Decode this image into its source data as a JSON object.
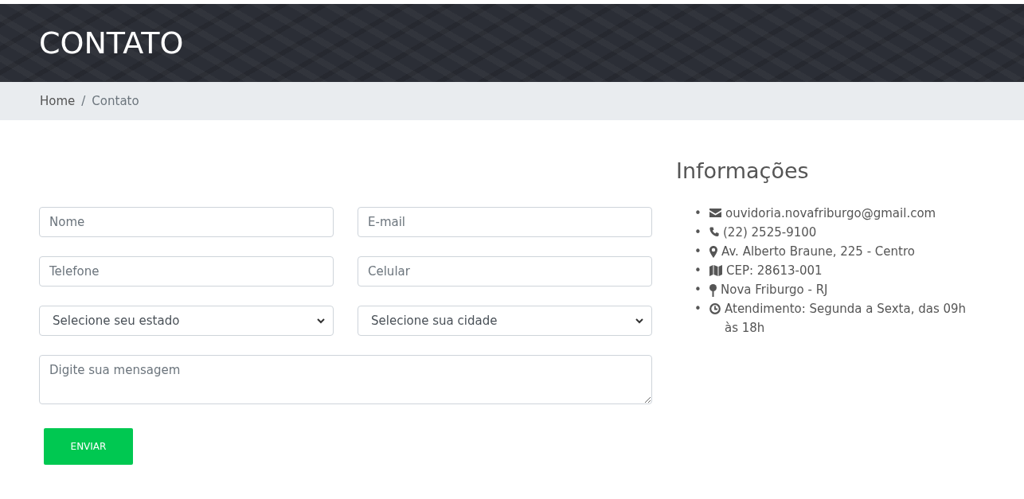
{
  "header": {
    "title": "CONTATO"
  },
  "breadcrumb": {
    "separator": "/",
    "items": [
      {
        "label": "Home",
        "link": true
      },
      {
        "label": "Contato",
        "link": false
      }
    ]
  },
  "form": {
    "fields": [
      {
        "kind": "input",
        "placeholder": "Nome"
      },
      {
        "kind": "input",
        "placeholder": "E-mail"
      },
      {
        "kind": "input",
        "placeholder": "Telefone"
      },
      {
        "kind": "input",
        "placeholder": "Celular"
      },
      {
        "kind": "select",
        "value": "Selecione seu estado"
      },
      {
        "kind": "select",
        "value": "Selecione sua cidade"
      },
      {
        "kind": "textarea",
        "placeholder": "Digite sua mensagem"
      }
    ],
    "submit": "ENVIAR"
  },
  "info": {
    "title": "Informações",
    "bullet": "•",
    "items": [
      {
        "kind": "email",
        "text": "ouvidoria.novafriburgo@gmail.com"
      },
      {
        "kind": "phone",
        "text": "(22) 2525-9100"
      },
      {
        "kind": "address",
        "text": "Av. Alberto Braune, 225 - Centro"
      },
      {
        "kind": "map",
        "text": "CEP: 28613-001"
      },
      {
        "kind": "city",
        "text": "Nova Friburgo - RJ"
      },
      {
        "kind": "hours",
        "text": "Atendimento: Segunda a Sexta, das 09h às 18h"
      }
    ]
  }
}
